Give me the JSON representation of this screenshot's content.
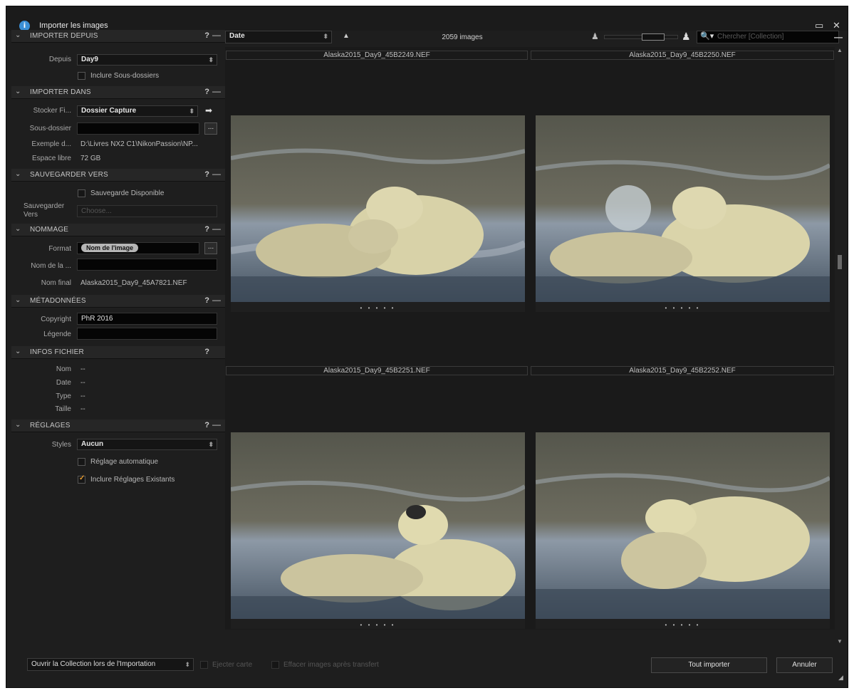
{
  "window": {
    "title": "Importer les images"
  },
  "sections": {
    "import_from": {
      "title": "IMPORTER DEPUIS",
      "from_label": "Depuis",
      "from_value": "Day9",
      "include_subfolders": "Inclure Sous-dossiers",
      "include_subfolders_checked": false
    },
    "import_to": {
      "title": "IMPORTER DANS",
      "store_label": "Stocker Fi...",
      "store_value": "Dossier Capture",
      "subfolder_label": "Sous-dossier",
      "subfolder_value": "",
      "example_label": "Exemple d...",
      "example_value": "D:\\Livres NX2 C1\\NikonPassion\\NP...",
      "free_space_label": "Espace libre",
      "free_space_value": "72 GB"
    },
    "backup": {
      "title": "SAUVEGARDER VERS",
      "backup_enabled": "Sauvegarde Disponible",
      "backup_enabled_checked": false,
      "backup_to_label": "Sauvegarder Vers",
      "backup_to_value": "Choose..."
    },
    "naming": {
      "title": "NOMMAGE",
      "format_label": "Format",
      "format_token": "Nom de l'image",
      "name_label": "Nom de la ...",
      "name_value": "",
      "final_name_label": "Nom final",
      "final_name_value": "Alaska2015_Day9_45A7821.NEF"
    },
    "metadata": {
      "title": "MÉTADONNÉES",
      "copyright_label": "Copyright",
      "copyright_value": "PhR 2016",
      "caption_label": "Légende",
      "caption_value": ""
    },
    "file_info": {
      "title": "INFOS FICHIER",
      "rows": [
        {
          "label": "Nom",
          "value": "--"
        },
        {
          "label": "Date",
          "value": "--"
        },
        {
          "label": "Type",
          "value": "--"
        },
        {
          "label": "Taille",
          "value": "--"
        }
      ]
    },
    "settings": {
      "title": "RÉGLAGES",
      "styles_label": "Styles",
      "styles_value": "Aucun",
      "auto_adjust": "Réglage automatique",
      "auto_adjust_checked": false,
      "include_existing": "Inclure Réglages Existants",
      "include_existing_checked": true
    }
  },
  "toolbar": {
    "sort_value": "Date",
    "image_count": "2059 images",
    "search_placeholder": "Chercher [Collection]"
  },
  "grid": {
    "top_row_names": [
      "Alaska2015_Day9_45B2249.NEF",
      "Alaska2015_Day9_45B2250.NEF"
    ],
    "images": [
      {
        "name": "",
        "rating_dots": "• • • • •"
      },
      {
        "name": "",
        "rating_dots": "• • • • •"
      },
      {
        "name": "Alaska2015_Day9_45B2251.NEF",
        "rating_dots": "• • • • •"
      },
      {
        "name": "Alaska2015_Day9_45B2252.NEF",
        "rating_dots": "• • • • •"
      }
    ]
  },
  "bottom": {
    "open_collection": "Ouvrir la Collection lors de l'Importation",
    "eject_card": "Ejecter carte",
    "delete_after": "Effacer images après transfert",
    "import_all": "Tout importer",
    "cancel": "Annuler"
  },
  "icons": {
    "app": "info-icon",
    "maximize": "maximize-icon",
    "close": "close-icon",
    "sort_direction": "triangle-up-icon",
    "search": "search-icon"
  },
  "colors": {
    "background": "#1e1e1e",
    "checkbox_accent": "#e59a2e",
    "app_icon": "#3a8fd6"
  }
}
